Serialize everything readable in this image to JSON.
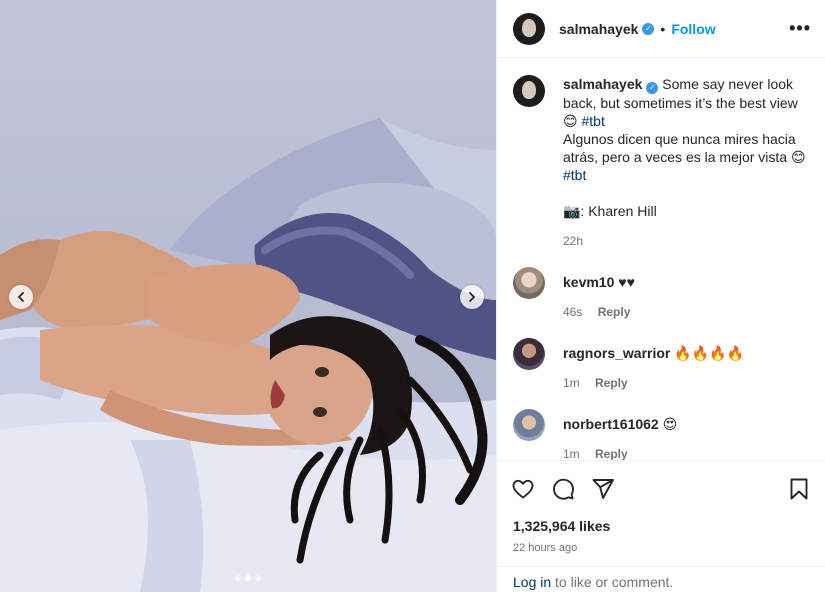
{
  "post": {
    "owner": {
      "username": "salmahayek",
      "verified_icon": "verified-badge-icon",
      "separator": "•",
      "follow_label": "Follow",
      "more_icon": "more-options-icon",
      "more_label": "•••"
    },
    "caption": {
      "line1": "Some say never look back, but sometimes it’s the best view 😊",
      "hashtag1": "#tbt",
      "line2": "Algunos dicen que nunca mires hacia atrás, pero a veces es la mejor vista 😊",
      "hashtag2": "#tbt",
      "credit": "📷: Kharen Hill",
      "time": "22h"
    },
    "comments": [
      {
        "username": "kevm10",
        "text": "♥♥",
        "time": "46s",
        "reply_label": "Reply"
      },
      {
        "username": "ragnors_warrior",
        "text": "🔥🔥🔥🔥",
        "time": "1m",
        "reply_label": "Reply"
      },
      {
        "username": "norbert161062",
        "text": "😍",
        "time": "1m",
        "reply_label": "Reply"
      }
    ],
    "actions": {
      "like_icon": "heart-icon",
      "comment_icon": "comment-icon",
      "share_icon": "share-icon",
      "save_icon": "bookmark-icon"
    },
    "likes": "1,325,964 likes",
    "posted_ago": "22 hours ago",
    "login": {
      "link_label": "Log in",
      "suffix": " to like or comment."
    },
    "carousel": {
      "total": 3,
      "active_index": 1
    }
  },
  "colors": {
    "link_blue": "#0095f6",
    "verified_blue": "#3897f0",
    "hashtag": "#00376b",
    "muted_text": "#737373"
  }
}
